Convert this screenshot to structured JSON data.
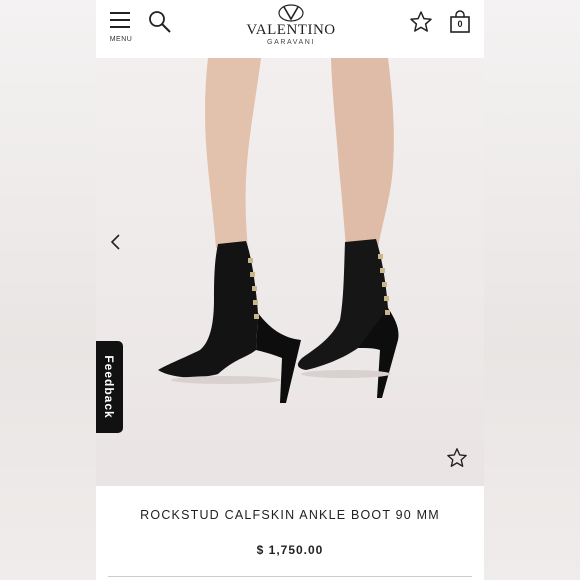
{
  "header": {
    "menu_label": "MENU",
    "brand": "VALENTINO",
    "brand_sub": "GARAVANI",
    "bag_count": "0"
  },
  "product": {
    "title": "ROCKSTUD CALFSKIN ANKLE BOOT 90 MM",
    "price": "$ 1,750.00"
  },
  "feedback": {
    "label": "Feedback"
  },
  "icons": {
    "menu": "hamburger-icon",
    "search": "search-icon",
    "wishlist": "star-icon",
    "bag": "shopping-bag-icon",
    "prev": "chevron-left-icon",
    "favorite": "star-icon"
  },
  "colors": {
    "text": "#222222",
    "background": "#ffffff",
    "feedback_tab": "#111111"
  }
}
